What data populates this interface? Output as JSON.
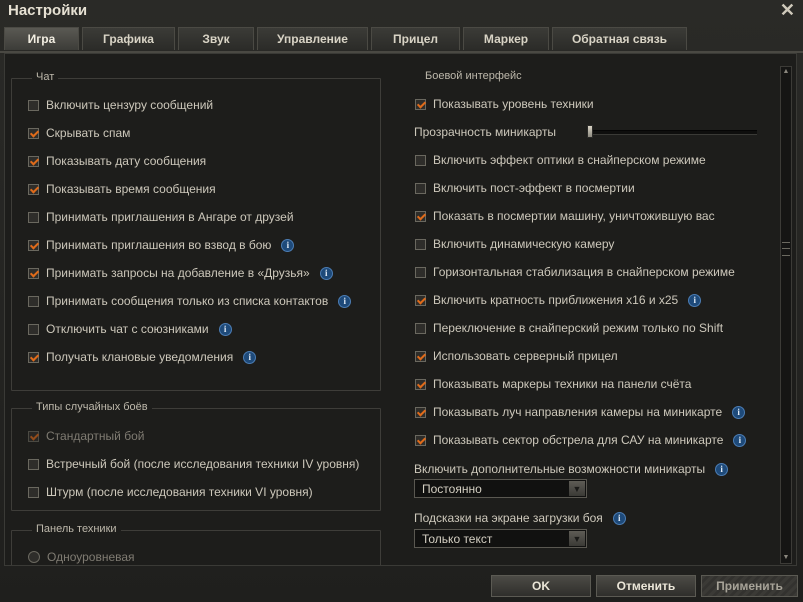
{
  "window": {
    "title": "Настройки"
  },
  "tabs": [
    {
      "label": "Игра",
      "active": true
    },
    {
      "label": "Графика"
    },
    {
      "label": "Звук"
    },
    {
      "label": "Управление"
    },
    {
      "label": "Прицел"
    },
    {
      "label": "Маркер"
    },
    {
      "label": "Обратная связь"
    }
  ],
  "chat": {
    "title": "Чат",
    "items": [
      {
        "label": "Включить цензуру сообщений",
        "checked": false
      },
      {
        "label": "Скрывать спам",
        "checked": true
      },
      {
        "label": "Показывать дату сообщения",
        "checked": true
      },
      {
        "label": "Показывать время сообщения",
        "checked": true
      },
      {
        "label": "Принимать приглашения в Ангаре от друзей",
        "checked": false
      },
      {
        "label": "Принимать приглашения во взвод в бою",
        "checked": true,
        "info": true
      },
      {
        "label": "Принимать запросы на добавление в «Друзья»",
        "checked": true,
        "info": true
      },
      {
        "label": "Принимать сообщения только из списка контактов",
        "checked": false,
        "info": true
      },
      {
        "label": "Отключить чат с союзниками",
        "checked": false,
        "info": true
      },
      {
        "label": "Получать клановые уведомления",
        "checked": true,
        "info": true
      }
    ]
  },
  "battle_types": {
    "title": "Типы случайных боёв",
    "items": [
      {
        "label": "Стандартный бой",
        "checked": true,
        "disabled": true
      },
      {
        "label": "Встречный бой (после исследования техники IV уровня)",
        "checked": false
      },
      {
        "label": "Штурм (после исследования техники VI уровня)",
        "checked": false
      }
    ]
  },
  "vehicle_panel": {
    "title": "Панель техники",
    "items": [
      {
        "label": "Одноуровневая"
      }
    ]
  },
  "battle_ui": {
    "title": "Боевой интерфейс",
    "show_tier": "Показывать уровень техники",
    "minimap_opacity_label": "Прозрачность миникарты",
    "minimap_opacity": 0,
    "items": [
      {
        "label": "Включить эффект оптики в снайперском режиме",
        "checked": false
      },
      {
        "label": "Включить пост-эффект в посмертии",
        "checked": false
      },
      {
        "label": "Показать в посмертии машину, уничтожившую вас",
        "checked": true
      },
      {
        "label": "Включить динамическую камеру",
        "checked": false
      },
      {
        "label": "Горизонтальная стабилизация в снайперском режиме",
        "checked": false
      },
      {
        "label": "Включить кратность приближения x16 и x25",
        "checked": true,
        "info": true
      },
      {
        "label": "Переключение в снайперский режим только по Shift",
        "checked": false
      },
      {
        "label": "Использовать серверный прицел",
        "checked": true
      },
      {
        "label": "Показывать маркеры техники на панели счёта",
        "checked": true
      },
      {
        "label": "Показывать луч направления камеры на миникарте",
        "checked": true,
        "info": true
      },
      {
        "label": "Показывать сектор обстрела для САУ на миникарте",
        "checked": true,
        "info": true
      }
    ],
    "minimap_extra_label": "Включить дополнительные возможности миникарты",
    "minimap_extra_value": "Постоянно",
    "loading_hints_label": "Подсказки на экране загрузки боя",
    "loading_hints_value": "Только текст"
  },
  "buttons": {
    "ok": "OK",
    "cancel": "Отменить",
    "apply": "Применить"
  },
  "icons": {
    "close": "close-icon",
    "info": "info-icon",
    "check": "check-icon"
  },
  "colors": {
    "check": "#e06b1a",
    "info": "#1e4a7a"
  }
}
